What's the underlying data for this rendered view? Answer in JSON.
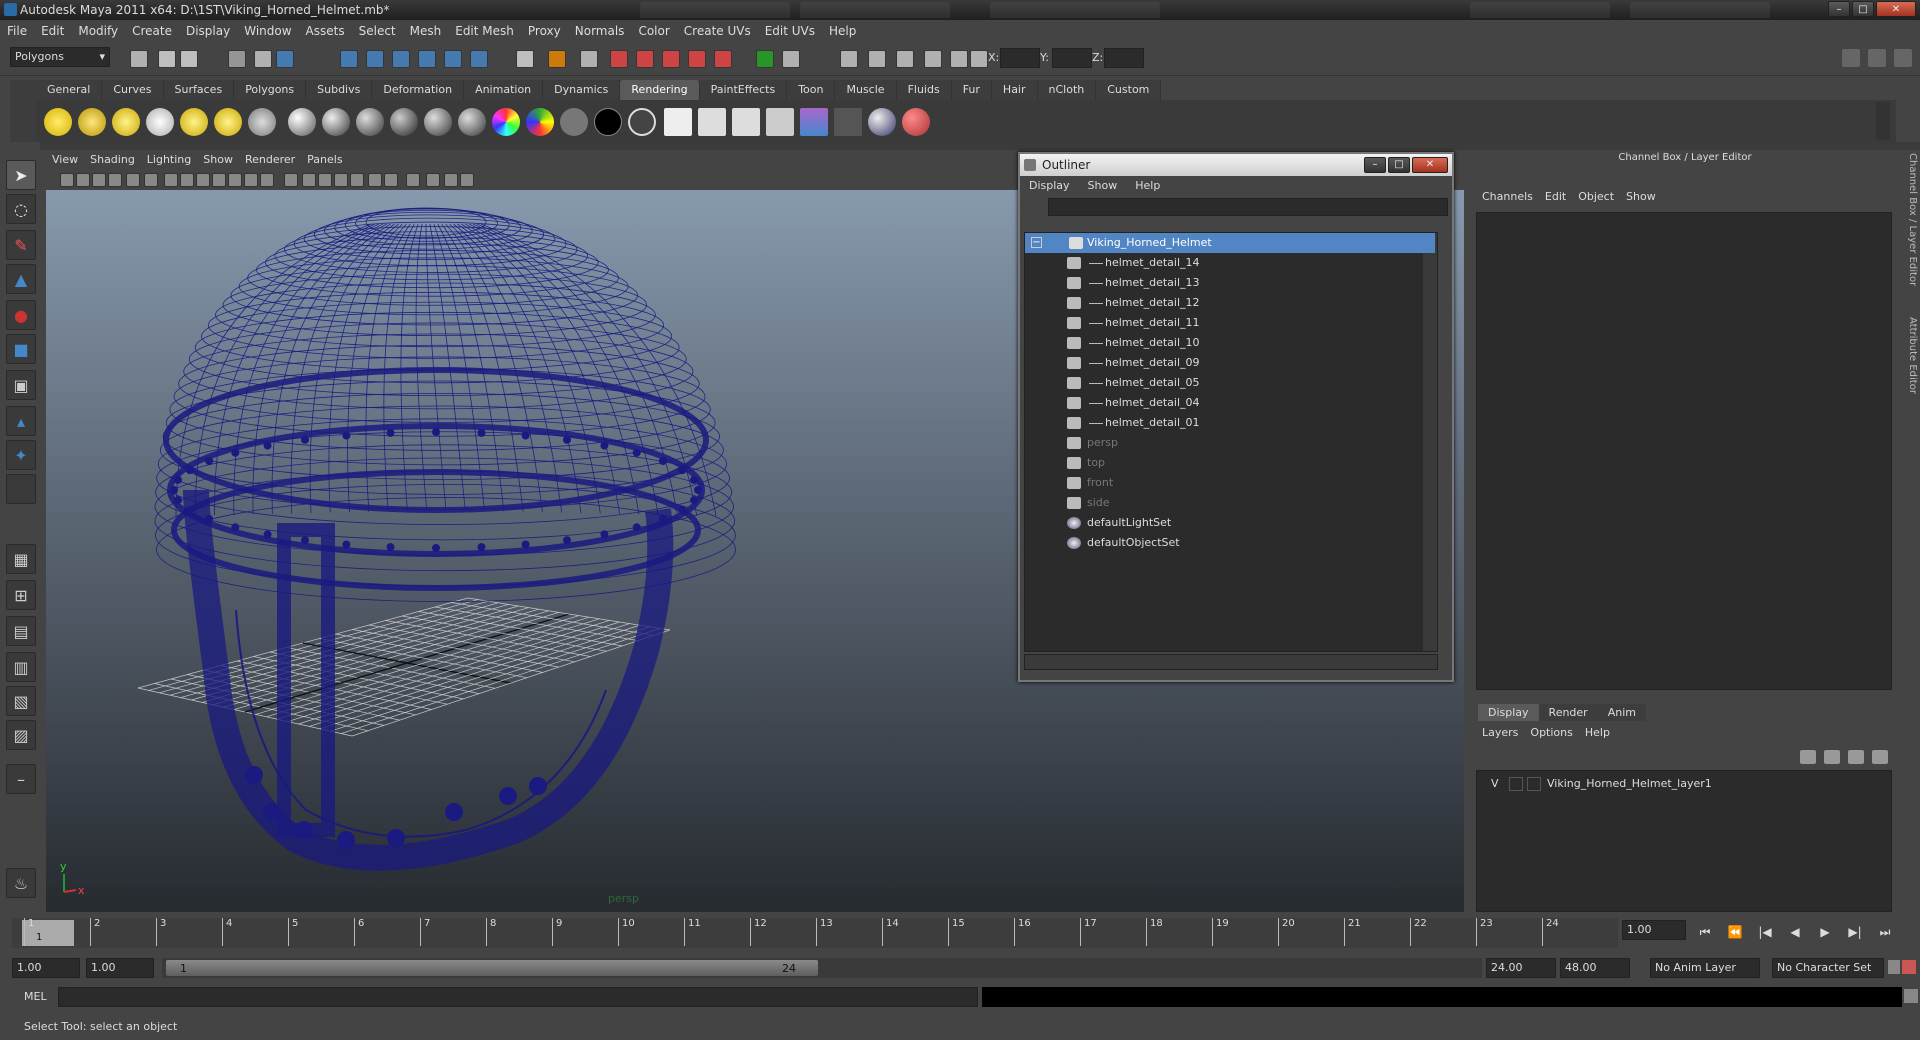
{
  "window": {
    "title": "Autodesk Maya 2011 x64: D:\\1ST\\Viking_Horned_Helmet.mb*",
    "min_glyph": "–",
    "max_glyph": "□",
    "close_glyph": "✕"
  },
  "menubar": [
    "File",
    "Edit",
    "Modify",
    "Create",
    "Display",
    "Window",
    "Assets",
    "Select",
    "Mesh",
    "Edit Mesh",
    "Proxy",
    "Normals",
    "Color",
    "Create UVs",
    "Edit UVs",
    "Help"
  ],
  "statusline": {
    "mode": "Polygons",
    "x_label": "X:",
    "y_label": "Y:",
    "z_label": "Z:"
  },
  "shelf": {
    "tabs": [
      "General",
      "Curves",
      "Surfaces",
      "Polygons",
      "Subdivs",
      "Deformation",
      "Animation",
      "Dynamics",
      "Rendering",
      "PaintEffects",
      "Toon",
      "Muscle",
      "Fluids",
      "Fur",
      "Hair",
      "nCloth",
      "Custom"
    ],
    "active_tab": "Rendering"
  },
  "viewport": {
    "menu": [
      "View",
      "Shading",
      "Lighting",
      "Show",
      "Renderer",
      "Panels"
    ],
    "camera_label": "persp",
    "axis_y": "y",
    "axis_x": "x",
    "wire_color": "#1a1a80"
  },
  "outliner": {
    "title": "Outliner",
    "menu": [
      "Display",
      "Show",
      "Help"
    ],
    "collapse_glyph": "−",
    "items": [
      {
        "label": "Viking_Horned_Helmet",
        "type": "group",
        "selected": true,
        "depth": 0,
        "dim": false
      },
      {
        "label": "helmet_detail_14",
        "type": "mesh",
        "selected": false,
        "depth": 1,
        "dim": false
      },
      {
        "label": "helmet_detail_13",
        "type": "mesh",
        "selected": false,
        "depth": 1,
        "dim": false
      },
      {
        "label": "helmet_detail_12",
        "type": "mesh",
        "selected": false,
        "depth": 1,
        "dim": false
      },
      {
        "label": "helmet_detail_11",
        "type": "mesh",
        "selected": false,
        "depth": 1,
        "dim": false
      },
      {
        "label": "helmet_detail_10",
        "type": "mesh",
        "selected": false,
        "depth": 1,
        "dim": false
      },
      {
        "label": "helmet_detail_09",
        "type": "mesh",
        "selected": false,
        "depth": 1,
        "dim": false
      },
      {
        "label": "helmet_detail_05",
        "type": "mesh",
        "selected": false,
        "depth": 1,
        "dim": false
      },
      {
        "label": "helmet_detail_04",
        "type": "mesh",
        "selected": false,
        "depth": 1,
        "dim": false
      },
      {
        "label": "helmet_detail_01",
        "type": "mesh",
        "selected": false,
        "depth": 1,
        "dim": false
      },
      {
        "label": "persp",
        "type": "camera",
        "selected": false,
        "depth": 0,
        "dim": true
      },
      {
        "label": "top",
        "type": "camera",
        "selected": false,
        "depth": 0,
        "dim": true
      },
      {
        "label": "front",
        "type": "camera",
        "selected": false,
        "depth": 0,
        "dim": true
      },
      {
        "label": "side",
        "type": "camera",
        "selected": false,
        "depth": 0,
        "dim": true
      },
      {
        "label": "defaultLightSet",
        "type": "set",
        "selected": false,
        "depth": 0,
        "dim": false
      },
      {
        "label": "defaultObjectSet",
        "type": "set",
        "selected": false,
        "depth": 0,
        "dim": false
      }
    ]
  },
  "channelbox": {
    "header": "Channel Box / Layer Editor",
    "menu": [
      "Channels",
      "Edit",
      "Object",
      "Show"
    ],
    "layer_tabs": [
      "Display",
      "Render",
      "Anim"
    ],
    "active_layer_tab": "Display",
    "layer_menu": [
      "Layers",
      "Options",
      "Help"
    ],
    "layers": [
      {
        "visible": "V",
        "name": "Viking_Horned_Helmet_layer1"
      }
    ],
    "side_tabs": [
      "Channel Box / Layer Editor",
      "Attribute Editor"
    ]
  },
  "timeslider": {
    "ticks": [
      "1",
      "2",
      "3",
      "4",
      "5",
      "6",
      "7",
      "8",
      "9",
      "10",
      "11",
      "12",
      "13",
      "14",
      "15",
      "16",
      "17",
      "18",
      "19",
      "20",
      "21",
      "22",
      "23",
      "24"
    ],
    "current_frame_marker": "1",
    "current_time": "1.00",
    "playback_glyphs": [
      "⏮",
      "⏪",
      "|◀",
      "◀",
      "▶",
      "▶|",
      "⏭"
    ]
  },
  "rangeslider": {
    "start_field": "1.00",
    "anim_start": "1.00",
    "range_start": "1",
    "range_end": "24",
    "range_end_field": "24.00",
    "anim_end": "48.00",
    "anim_layer": "No Anim Layer",
    "character_set": "No Character Set"
  },
  "cmdline": {
    "label": "MEL"
  },
  "helpline": {
    "text": "Select Tool: select an object"
  }
}
